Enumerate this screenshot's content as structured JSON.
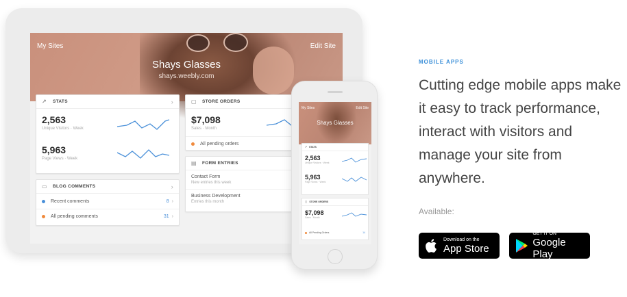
{
  "tablet": {
    "hero": {
      "my_sites": "My Sites",
      "edit_site": "Edit Site",
      "site_name": "Shays Glasses",
      "site_url": "shays.weebly.com"
    },
    "stats": {
      "title": "STATS",
      "visitors_value": "2,563",
      "visitors_label": "Unique Visitors · Week",
      "views_value": "5,963",
      "views_label": "Page Views · Week"
    },
    "store_orders": {
      "title": "STORE ORDERS",
      "sales_value": "$7,098",
      "sales_label": "Sales · Month",
      "pending": "All pending orders"
    },
    "blog_comments": {
      "title": "BLOG COMMENTS",
      "rows": [
        {
          "label": "Recent comments",
          "count": "8",
          "dot_color": "#4a90d9"
        },
        {
          "label": "All pending comments",
          "count": "31",
          "dot_color": "#f08a3c"
        }
      ]
    },
    "form_entries": {
      "title": "FORM ENTRIES",
      "rows": [
        {
          "title": "Contact Form",
          "subtitle": "New entries this week"
        },
        {
          "title": "Business Development",
          "subtitle": "Entries this month"
        }
      ]
    }
  },
  "phone": {
    "my_sites": "My Sites",
    "edit_site": "Edit Site",
    "site_name": "Shays Glasses",
    "stats_title": "STATS",
    "visitors_value": "2,563",
    "visitors_label": "Unique Visitors · Week",
    "views_value": "5,963",
    "views_label": "Page Views · Week",
    "orders_title": "STORE ORDERS",
    "sales_value": "$7,098",
    "sales_label": "Sales · Month",
    "pending": "All Pending Orders",
    "pending_count": "14"
  },
  "marketing": {
    "eyebrow": "MOBILE APPS",
    "headline": "Cutting edge mobile apps make it easy to track performance, interact with visitors and manage your site from anywhere.",
    "available": "Available:",
    "app_store_small": "Download on the",
    "app_store_big": "App Store",
    "google_small": "GET IT ON",
    "google_big": "Google Play"
  },
  "colors": {
    "accent": "#3b8fd8",
    "hero": "#c9907c",
    "orange": "#f08a3c"
  }
}
